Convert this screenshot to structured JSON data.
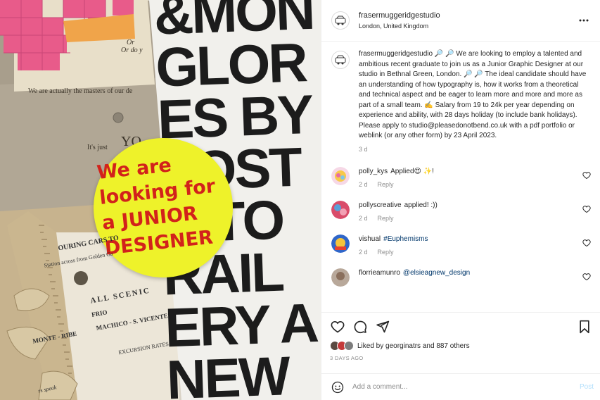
{
  "photo": {
    "poster_lines": [
      "&MON",
      "GLOR",
      "ES BY",
      "VOST",
      "DITO",
      "RAIL",
      "ERY A",
      "NEW"
    ],
    "sticker_lines": [
      "We are",
      "looking for",
      "a JUNIOR",
      "DESIGNER"
    ],
    "small_print": {
      "line1": "We are actually the masters of our de",
      "line2": "It's just",
      "line3": "YO",
      "corner1": "Or",
      "corner2": "Or do y"
    },
    "ticket": {
      "title": "OURING CARS TO",
      "sub": "Station across from Golden Ga",
      "scenic": "ALL SCENIC",
      "frio": "FRIO",
      "machico": "MACHICO - S. VICENTE",
      "monte": "MONTE - RIBE",
      "rates": "EXCURSION RATES",
      "speak": "rs speak"
    }
  },
  "header": {
    "username": "frasermuggeridgestudio",
    "location": "London, United Kingdom"
  },
  "caption": {
    "username": "frasermuggeridgestudio",
    "text": "🔎 🔎 We are looking to employ a talented and ambitious recent graduate to join us as a Junior Graphic Designer at our studio in Bethnal Green, London. 🔎 🔎 The ideal candidate should have an understanding of how typography is, how it works from a theoretical and technical aspect and be eager to learn more and more and more as part of a small team. ✍️ Salary from 19 to 24k per year depending on experience and ability, with 28 days holiday (to include bank holidays). Please apply to studio@pleasedonotbend.co.uk with a pdf portfolio or weblink (or any other form) by 23 April 2023.",
    "time": "3 d"
  },
  "comments": [
    {
      "user": "polly_kys",
      "text": "Applied😍 ✨!",
      "mention": "",
      "time": "2 d",
      "reply": "Reply"
    },
    {
      "user": "pollyscreative",
      "text": "applied! :))",
      "mention": "",
      "time": "2 d",
      "reply": "Reply"
    },
    {
      "user": "vishual",
      "text": "",
      "mention": "#Euphemisms",
      "time": "2 d",
      "reply": "Reply"
    },
    {
      "user": "florrieamunro",
      "text": "",
      "mention": "@elsieagnew_design",
      "time": "",
      "reply": ""
    }
  ],
  "likes": {
    "prefix": "Liked by ",
    "user": "georginatrs",
    "middle": " and ",
    "count": "887 others"
  },
  "posted_ago": "3 DAYS AGO",
  "add_comment": {
    "placeholder": "Add a comment...",
    "post_label": "Post"
  },
  "colors": {
    "sticker": "#eef22a",
    "sticker_ink": "#d2221b",
    "mention": "#00376b",
    "post_disabled": "#b2dffc"
  }
}
